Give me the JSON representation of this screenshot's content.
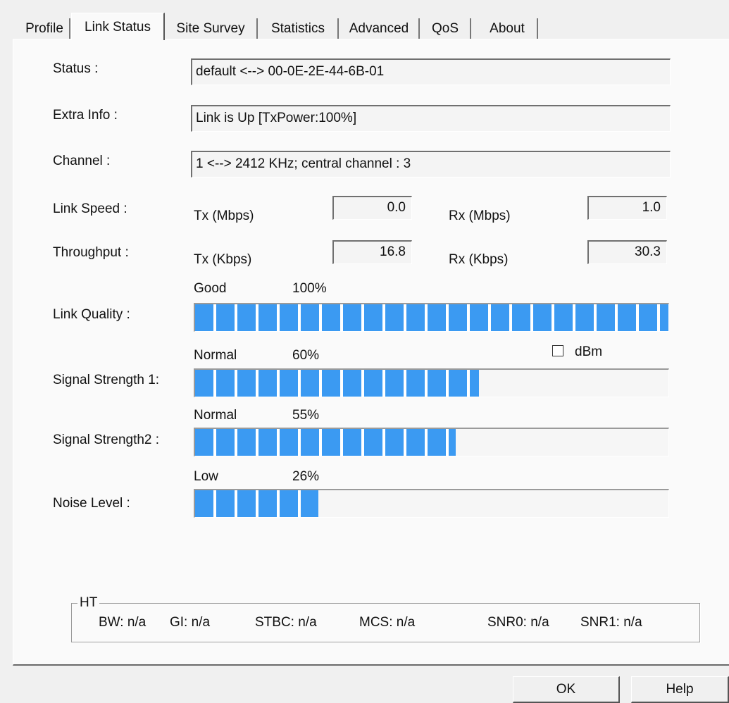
{
  "tabs": [
    "Profile",
    "Link Status",
    "Site Survey",
    "Statistics",
    "Advanced",
    "QoS",
    "About"
  ],
  "labels": {
    "status": "Status :",
    "extra_info": "Extra Info :",
    "channel": "Channel :",
    "link_speed": "Link Speed :",
    "throughput": "Throughput :",
    "link_quality": "Link Quality :",
    "signal1": "Signal Strength 1:",
    "signal2": "Signal Strength2 :",
    "noise": "Noise Level :"
  },
  "fields": {
    "status": "default <--> 00-0E-2E-44-6B-01",
    "extra_info": "Link is Up [TxPower:100%]",
    "channel": "1 <--> 2412 KHz; central channel : 3"
  },
  "link_speed": {
    "tx_label": "Tx (Mbps)",
    "tx_value": "0.0",
    "rx_label": "Rx (Mbps)",
    "rx_value": "1.0"
  },
  "throughput": {
    "tx_label": "Tx (Kbps)",
    "tx_value": "16.8",
    "rx_label": "Rx (Kbps)",
    "rx_value": "30.3"
  },
  "link_quality": {
    "level": "Good",
    "percent_text": "100%",
    "percent": 100
  },
  "signal1": {
    "level": "Normal",
    "percent_text": "60%",
    "percent": 60
  },
  "signal2": {
    "level": "Normal",
    "percent_text": "55%",
    "percent": 55
  },
  "noise": {
    "level": "Low",
    "percent_text": "26%",
    "percent": 26
  },
  "dbm": {
    "label": "dBm",
    "checked": false
  },
  "ht": {
    "title": "HT",
    "bw": "BW: n/a",
    "gi": "GI: n/a",
    "stbc": "STBC: n/a",
    "mcs": "MCS: n/a",
    "snr0": "SNR0: n/a",
    "snr1": "SNR1: n/a"
  },
  "buttons": {
    "ok": "OK",
    "help": "Help"
  },
  "colors": {
    "bar_fill": "#3b9af2"
  }
}
